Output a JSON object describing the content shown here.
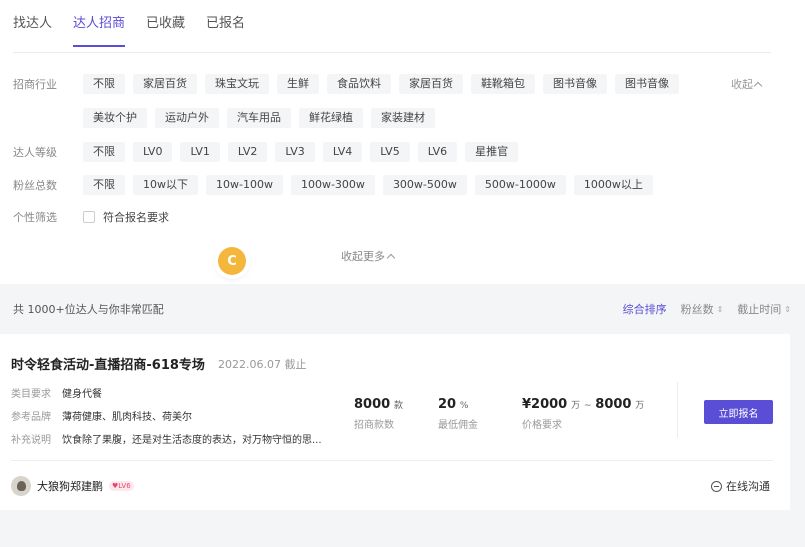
{
  "tabs": [
    {
      "label": "找达人"
    },
    {
      "label": "达人招商"
    },
    {
      "label": "已收藏"
    },
    {
      "label": "已报名"
    }
  ],
  "filters": {
    "industry": {
      "label": "招商行业",
      "row1": [
        "不限",
        "家居百货",
        "珠宝文玩",
        "生鲜",
        "食品饮料",
        "家居百货",
        "鞋靴箱包",
        "图书音像",
        "图书音像"
      ],
      "row2": [
        "美妆个护",
        "运动户外",
        "汽车用品",
        "鲜花绿植",
        "家装建材"
      ],
      "collapse_label": "收起"
    },
    "level": {
      "label": "达人等级",
      "options": [
        "不限",
        "LV0",
        "LV1",
        "LV2",
        "LV3",
        "LV4",
        "LV5",
        "LV6",
        "星推官"
      ]
    },
    "fans": {
      "label": "粉丝总数",
      "options": [
        "不限",
        "10w以下",
        "10w-100w",
        "100w-300w",
        "300w-500w",
        "500w-1000w",
        "1000w以上"
      ]
    },
    "personal": {
      "label": "个性筛选",
      "checkbox_label": "符合报名要求"
    },
    "more_collapse": "收起更多",
    "avatar_letter": "C"
  },
  "results": {
    "count_text": "共 1000+位达人与你非常匹配",
    "sorts": [
      {
        "label": "综合排序"
      },
      {
        "label": "粉丝数"
      },
      {
        "label": "截止时间"
      }
    ]
  },
  "card": {
    "title": "时令轻食活动-直播招商-618专场",
    "date": "2022.06.07 截止",
    "info": [
      {
        "key": "类目要求",
        "value": "健身代餐"
      },
      {
        "key": "参考品牌",
        "value": "薄荷健康、肌肉科技、荷美尔"
      },
      {
        "key": "补充说明",
        "value": "饮食除了果腹，还是对生活态度的表达，对万物守恒的思..."
      }
    ],
    "metrics": [
      {
        "value": "8000",
        "unit": "款",
        "label": "招商款数"
      },
      {
        "value": "20",
        "unit": "%",
        "label": "最低佣金"
      },
      {
        "value_prefix": "¥2000",
        "unit1": "万",
        "sep": "~",
        "value2": "8000",
        "unit2": "万",
        "label": "价格要求"
      }
    ],
    "apply_label": "立即报名",
    "owner_name": "大狼狗郑建鹏",
    "owner_level": "♥LV6",
    "chat_label": "在线沟通"
  }
}
